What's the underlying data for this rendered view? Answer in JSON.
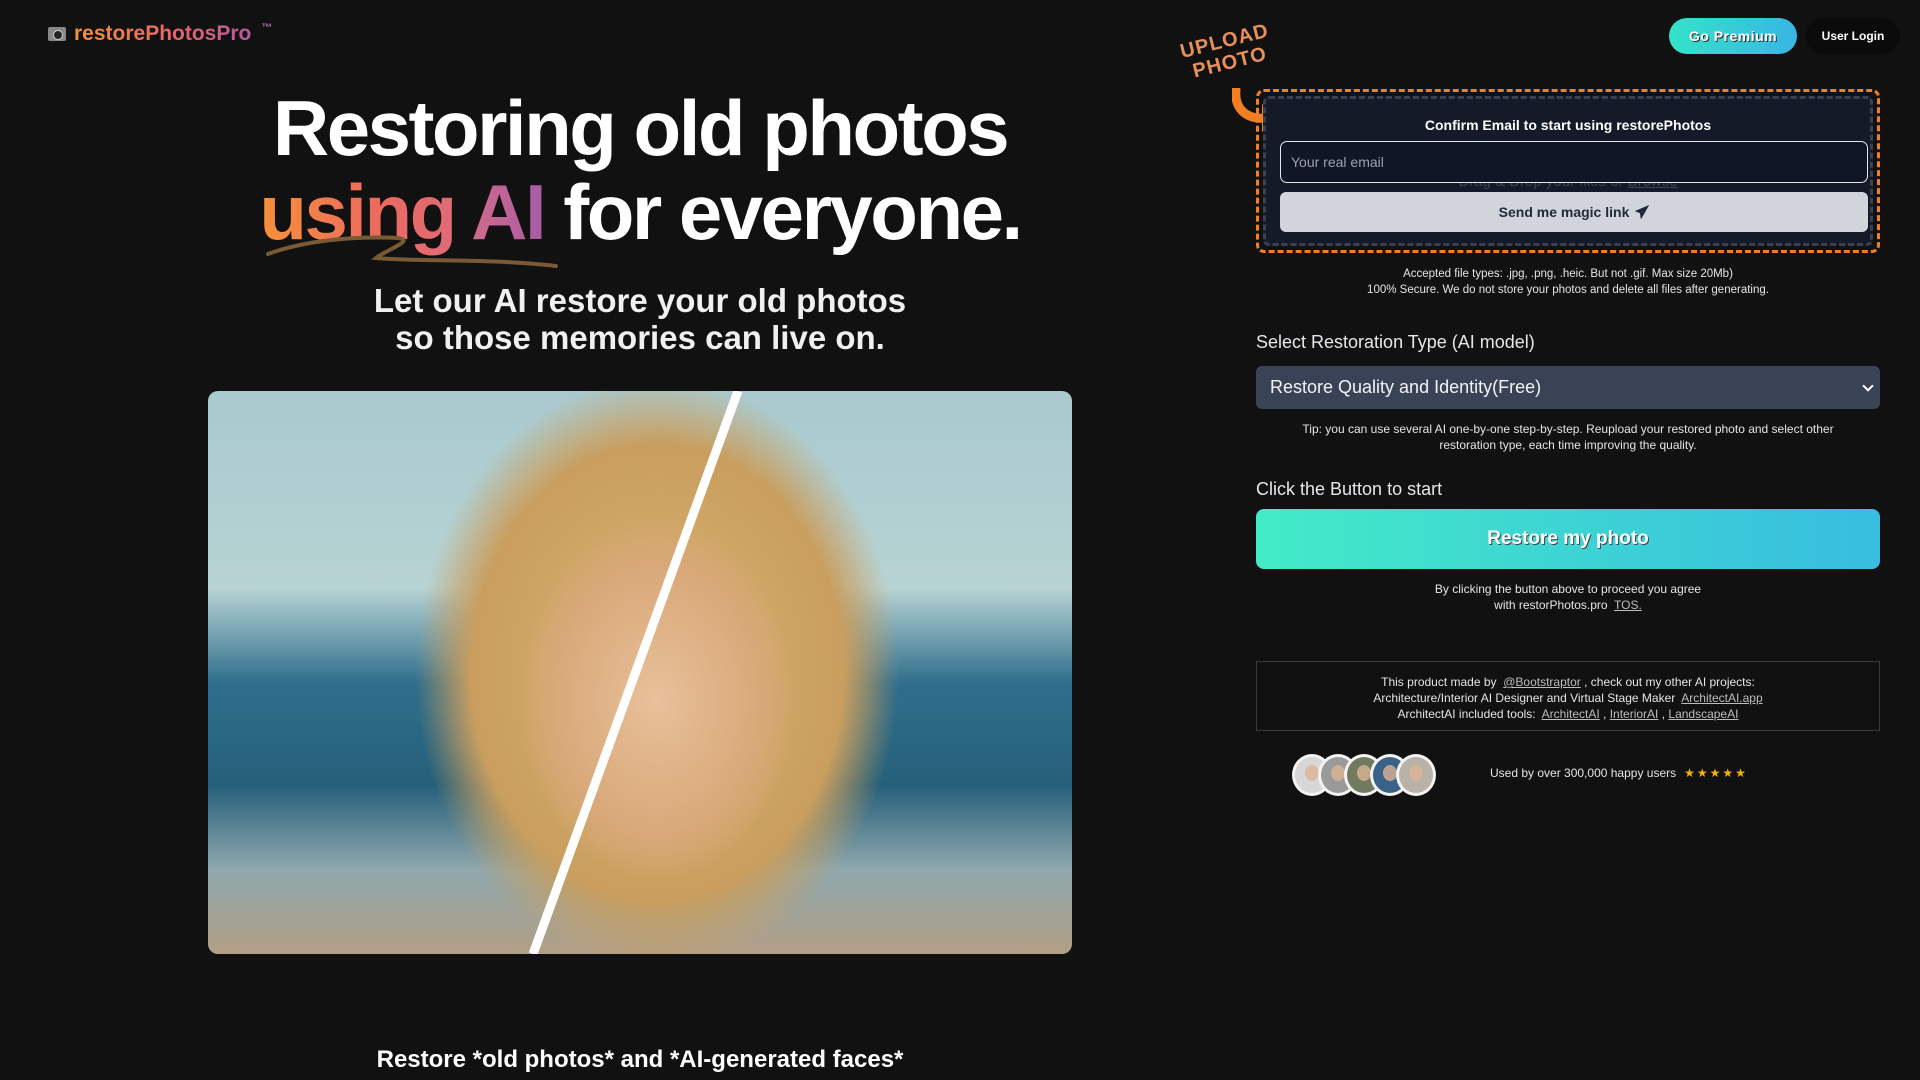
{
  "header": {
    "logo_text": "restorePhotosPro",
    "logo_tm": "™",
    "logo_icon": "camera-icon",
    "premium_label": "Go Premium",
    "login_label": "User Login"
  },
  "hero": {
    "title_line1": "Restoring old photos",
    "title_grad1": "using",
    "title_grad2": "AI",
    "title_rest": "for everyone.",
    "subtitle_line1": "Let our AI restore your old photos",
    "subtitle_line2": "so those memories can live on.",
    "photo_caption": "Restore *old photos* and *AI-generated faces*"
  },
  "upload": {
    "hint_line1": "UPLOAD",
    "hint_line2": "PHOTO",
    "confirm_title": "Confirm Email to start using restorePhotos",
    "drag_text": "Drag & Drop your files or",
    "drag_link": "Browse",
    "email_placeholder": "Your real email",
    "email_value": "",
    "magic_link_label": "Send me magic link",
    "accepted_line1": "Accepted file types: .jpg, .png, .heic. But not .gif. Max size 20Mb)",
    "accepted_line2": "100% Secure. We do not store your photos and delete all files after generating."
  },
  "restoration": {
    "label": "Select Restoration Type (AI model)",
    "selected": "Restore Quality and Identity(Free)",
    "tip": "Tip: you can use several AI one-by-one step-by-step. Reupload your restored photo and select other restoration type, each time improving the quality."
  },
  "start": {
    "label": "Click the Button to start",
    "button": "Restore my photo",
    "tos_line1": "By clicking the button above to proceed you agree",
    "tos_line2": "with restorPhotos.pro",
    "tos_link": "TOS."
  },
  "credits": {
    "made_by": "This product made by",
    "author_link": "@Bootstraptor",
    "made_by_rest": ", check out my other AI projects:",
    "line2": "Architecture/Interior AI Designer and Virtual Stage Maker",
    "architect_app_link": "ArchitectAI.app",
    "line3": "ArchitectAI included tools:",
    "tools": [
      "ArchitectAI",
      "InteriorAI",
      "LandscapeAI"
    ]
  },
  "social_proof": {
    "text": "Used by over 300,000 happy users",
    "stars": "★★★★★",
    "rating": 5,
    "avatar_count": 5
  },
  "colors": {
    "background": "#111111",
    "accent_teal": "#43ebc7",
    "accent_blue": "#37bde0",
    "upload_border": "#f27f21",
    "star": "#f5b400"
  }
}
